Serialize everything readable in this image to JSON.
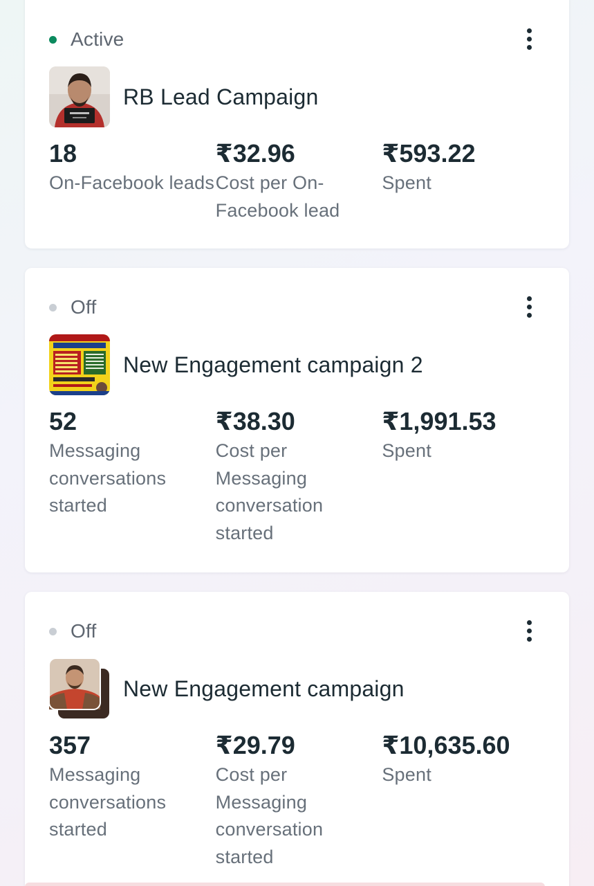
{
  "campaigns": [
    {
      "status": "Active",
      "status_color": "#0b8a5e",
      "name": "RB Lead Campaign",
      "metrics": [
        {
          "value": "18",
          "label": "On-Facebook leads"
        },
        {
          "value": "₹32.96",
          "label": "Cost per On-Facebook lead"
        },
        {
          "value": "₹593.22",
          "label": "Spent"
        }
      ]
    },
    {
      "status": "Off",
      "status_color": "#c9ced4",
      "name": "New Engagement campaign 2",
      "metrics": [
        {
          "value": "52",
          "label": "Messaging conversations started"
        },
        {
          "value": "₹38.30",
          "label": "Cost per Messaging conversation started"
        },
        {
          "value": "₹1,991.53",
          "label": "Spent"
        }
      ]
    },
    {
      "status": "Off",
      "status_color": "#c9ced4",
      "name": "New Engagement campaign",
      "metrics": [
        {
          "value": "357",
          "label": "Messaging conversations started"
        },
        {
          "value": "₹29.79",
          "label": "Cost per Messaging conversation started"
        },
        {
          "value": "₹10,635.60",
          "label": "Spent"
        }
      ]
    }
  ]
}
